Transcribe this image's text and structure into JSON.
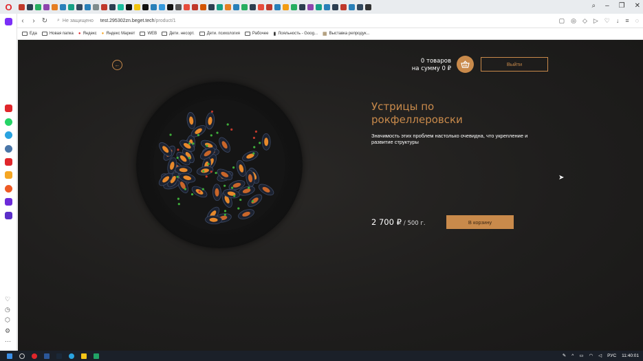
{
  "browser": {
    "address": {
      "security": "Не защищено",
      "host": "test.295302zn.beget.tech",
      "path": "/product/1"
    },
    "bookmarks": [
      "Еда",
      "Новая папка",
      "Яндекс",
      "Яндекс Маркет",
      "WEB",
      "Дети. несорт.",
      "Дети. психология",
      "Рабочее",
      "Лояльность - Goog...",
      "Выставка репродук..."
    ],
    "colors": {
      "accent": "#c98a4b"
    }
  },
  "header": {
    "cart_count": "0 товаров",
    "cart_sum": "на сумму 0 ₽",
    "logout_label": "Выйти"
  },
  "product": {
    "title": "Устрицы по рокфеллеровски",
    "description": "Значимость этих проблем настолько очевидна, что укрепление и развитие структуры",
    "price": "2 700 ₽",
    "weight": "/ 500 г.",
    "add_to_cart_label": "В корзину"
  },
  "taskbar": {
    "lang": "РУС",
    "time": "11:40:01"
  }
}
